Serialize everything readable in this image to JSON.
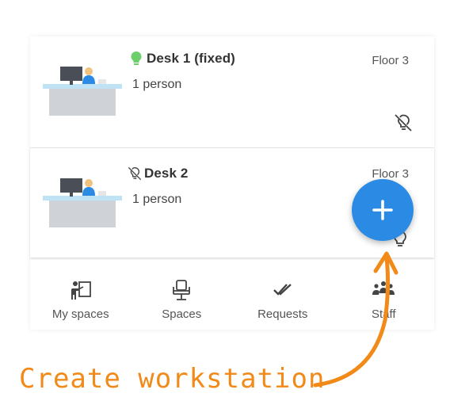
{
  "desks": [
    {
      "title": "Desk 1 (fixed)",
      "subtitle": "1 person",
      "floor": "Floor 3",
      "status_icon": "bulb-green-icon",
      "corner_icon": "bulb-off-icon"
    },
    {
      "title": "Desk 2",
      "subtitle": "1 person",
      "floor": "Floor 3",
      "status_icon": "bulb-off-icon",
      "corner_icon": "bulb-outline-icon"
    }
  ],
  "nav": [
    {
      "label": "My spaces",
      "icon": "my-spaces-icon"
    },
    {
      "label": "Spaces",
      "icon": "chair-icon"
    },
    {
      "label": "Requests",
      "icon": "double-check-icon"
    },
    {
      "label": "Staff",
      "icon": "staff-icon"
    }
  ],
  "fab": {
    "icon": "plus-icon"
  },
  "annotation": {
    "text": "Create workstation"
  },
  "colors": {
    "fab": "#2a8ae4",
    "annotation": "#f28a1a",
    "bulb_green": "#6ccf6c"
  }
}
